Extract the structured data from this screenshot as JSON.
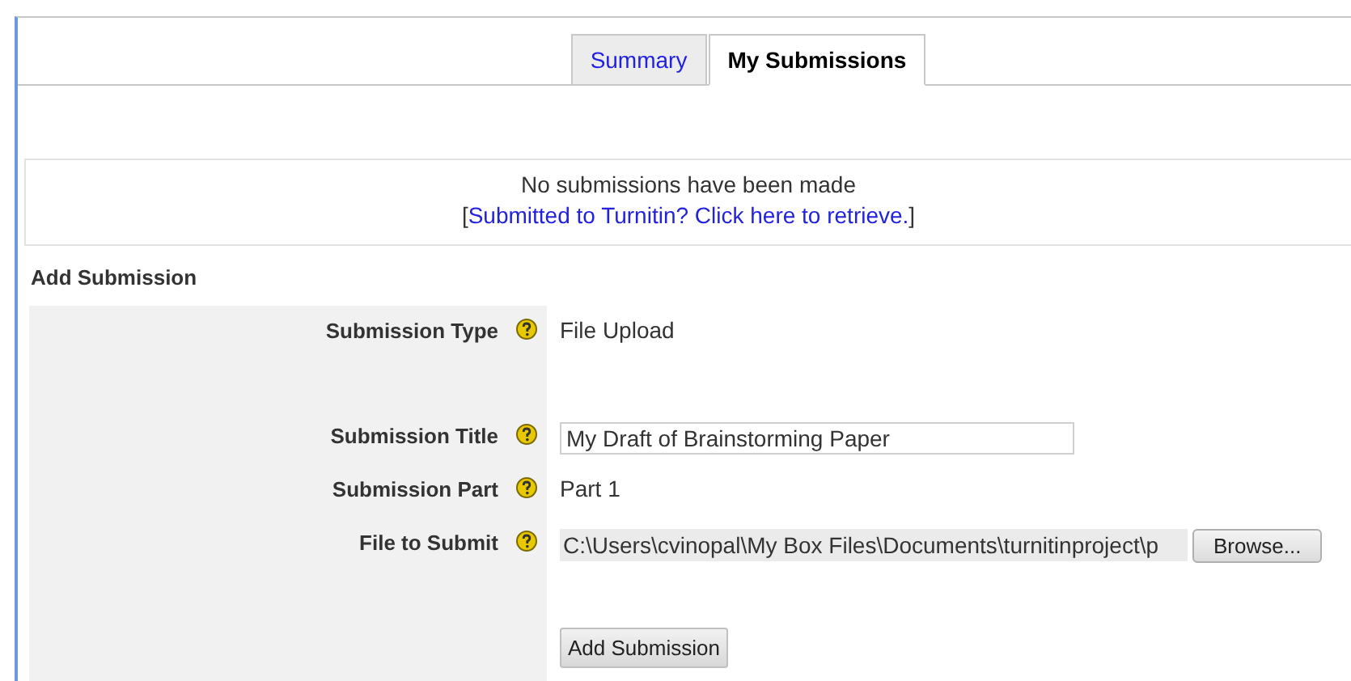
{
  "tabs": [
    {
      "label": "Summary",
      "selected": false
    },
    {
      "label": "My Submissions",
      "selected": true
    }
  ],
  "notice": {
    "message": "No submissions have been made",
    "link_prefix": "[",
    "link": "Submitted to Turnitin? Click here to retrieve.",
    "link_suffix": "]"
  },
  "form": {
    "heading": "Add Submission",
    "fields": [
      {
        "kind": "text",
        "label": "Submission Type",
        "value": "File Upload"
      },
      {
        "kind": "input",
        "label": "Submission Title",
        "value": "My Draft of Brainstorming Paper"
      },
      {
        "kind": "text",
        "label": "Submission Part",
        "value": "Part 1"
      },
      {
        "kind": "file",
        "label": "File to Submit",
        "value": "C:\\Users\\cvinopal\\My Box Files\\Documents\\turnitinproject\\p",
        "button": "Browse..."
      }
    ],
    "submit": "Add Submission"
  }
}
